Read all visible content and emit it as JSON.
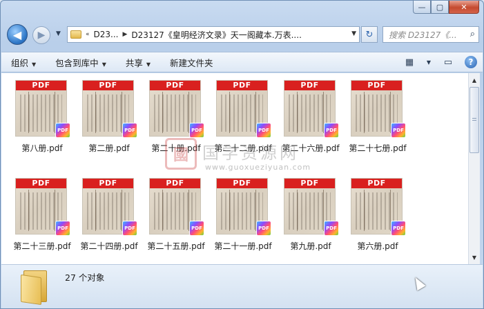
{
  "window": {
    "minimize_glyph": "—",
    "maximize_glyph": "▢",
    "close_glyph": "✕"
  },
  "nav": {
    "back_glyph": "◀",
    "forward_glyph": "▶",
    "history_glyph": "▼",
    "breadcrumb_overflow": "«",
    "breadcrumb": [
      "D23...",
      "D23127《皇明经济文录》天一阁藏本.万表...."
    ],
    "search_placeholder": "搜索 D23127《...",
    "refresh_glyph": "↻",
    "search_glyph": "⌕"
  },
  "toolbar": {
    "items": [
      {
        "label": "组织"
      },
      {
        "label": "包含到库中"
      },
      {
        "label": "共享"
      },
      {
        "label": "新建文件夹"
      }
    ],
    "dropdown_glyph": "▼",
    "view_glyph": "▦",
    "preview_glyph": "▭",
    "help_glyph": "?"
  },
  "files": [
    {
      "name": "第八册.pdf"
    },
    {
      "name": "第二册.pdf"
    },
    {
      "name": "第二十册.pdf"
    },
    {
      "name": "第二十二册.pdf"
    },
    {
      "name": "第二十六册.pdf"
    },
    {
      "name": "第二十七册.pdf"
    },
    {
      "name": "第二十三册.pdf"
    },
    {
      "name": "第二十四册.pdf"
    },
    {
      "name": "第二十五册.pdf"
    },
    {
      "name": "第二十一册.pdf"
    },
    {
      "name": "第九册.pdf"
    },
    {
      "name": "第六册.pdf"
    }
  ],
  "file_band_label": "PDF",
  "file_badge_label": "PDF",
  "watermark": {
    "seal_text": "國",
    "text": "国学资源网",
    "url": "www.guoxueziyuan.com"
  },
  "status": {
    "count_text": "27 个对象"
  },
  "colors": {
    "pdf_red": "#d9201f",
    "accent_blue": "#2f78c8"
  }
}
